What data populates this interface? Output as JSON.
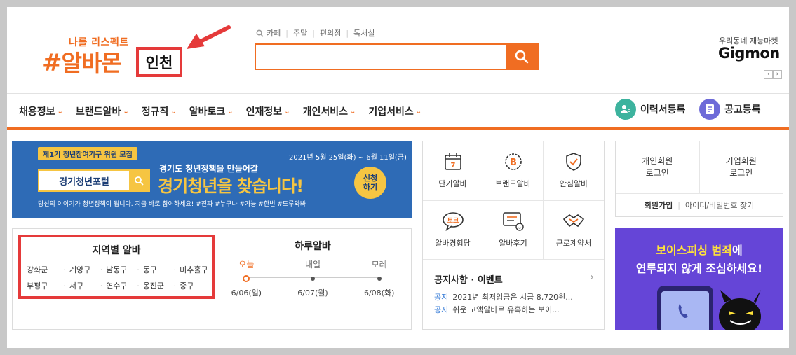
{
  "header": {
    "logo_sub": "나를 리스펙트",
    "logo_hash": "#",
    "logo_main": "알바몬",
    "region": "인천",
    "quick_links": [
      "카페",
      "주말",
      "편의점",
      "독서실"
    ],
    "search_placeholder": "",
    "gigmon_sub": "우리동네 재능마켓",
    "gigmon_logo": "Gigmon",
    "gigmon_prev": "‹",
    "gigmon_next": "›"
  },
  "nav": {
    "items": [
      "채용정보",
      "브랜드알바",
      "정규직",
      "알바토크",
      "인재정보",
      "개인서비스",
      "기업서비스"
    ],
    "resume": "이력서등록",
    "post": "공고등록",
    "chev": "⌄"
  },
  "banner": {
    "tag": "제1기 청년참여기구 위원 모집",
    "search_label": "경기청년포털",
    "date": "2021년 5월 25일(화) ~ 6월 11일(금)",
    "line1": "경기도 청년정책을 만들어갈",
    "line2": "경기청년을 찾습니다!",
    "apply_1": "신청",
    "apply_2": "하기",
    "bottom": "당신의 이야기가 청년정책이 됩니다. 지금 바로 참여하세요! #진짜 #누구나 #가능 #한번 #드루와봐"
  },
  "region": {
    "title": "지역별 알바",
    "row1": [
      "강화군",
      "계양구",
      "남동구",
      "동구",
      "미추홀구"
    ],
    "row2": [
      "부평구",
      "서구",
      "연수구",
      "옹진군",
      "중구"
    ]
  },
  "daily": {
    "title": "하루알바",
    "days": [
      {
        "label": "오늘",
        "date": "6/06(일)"
      },
      {
        "label": "내일",
        "date": "6/07(월)"
      },
      {
        "label": "모레",
        "date": "6/08(화)"
      }
    ]
  },
  "services": {
    "items": [
      "단기알바",
      "브랜드알바",
      "안심알바",
      "알바경험담",
      "알바후기",
      "근로계약서"
    ],
    "calendar_num": "7",
    "brand_letter": "B",
    "talk": "토크"
  },
  "notice": {
    "title": "공지사항 · 이벤트",
    "arrow": "›",
    "items": [
      {
        "tag": "공지",
        "text": "2021년 최저임금은 시급 8,720원..."
      },
      {
        "tag": "공지",
        "text": "쉬운 고액알바로 유혹하는 보이..."
      }
    ]
  },
  "login": {
    "personal_1": "개인회원",
    "personal_2": "로그인",
    "company_1": "기업회원",
    "company_2": "로그인",
    "join": "회원가입",
    "find": "아이디/비밀번호 찾기"
  },
  "promo": {
    "line1_a": "보이스피싱 범죄",
    "line1_b": "에",
    "line2": "연루되지 않게 조심하세요!"
  },
  "colors": {
    "accent": "#f06d22",
    "highlight": "#e53a3a",
    "banner_bg": "#2e6bb6",
    "promo_bg": "#6545d7"
  }
}
